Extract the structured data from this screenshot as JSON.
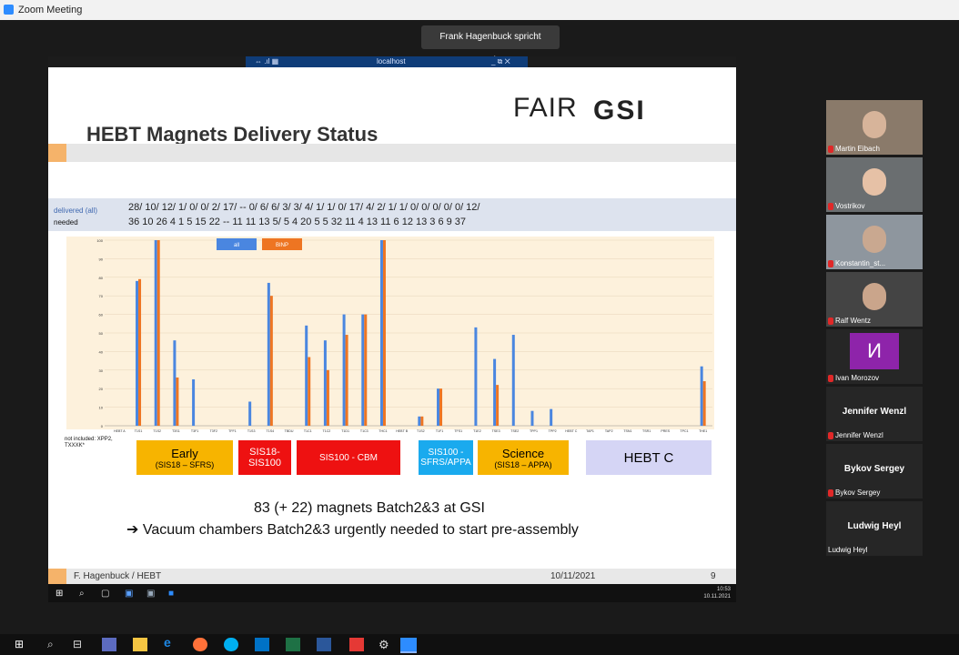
{
  "window": {
    "title": "Zoom Meeting"
  },
  "speaking_banner": "Frank Hagenbuck spricht gerade...",
  "remote_desktop": {
    "host": "localhost",
    "left_icons": "⇔ .ıl ▦",
    "controls": "_  ⧉  ✕"
  },
  "slide": {
    "logo_fair": "FAIR",
    "logo_gsi": "GSI",
    "title": "HEBT Magnets Delivery Status",
    "row_label_delivered": "delivered (all)",
    "row_label_needed": "needed",
    "delivered_values": "28/ 10/ 12/ 1/  0/  0/  2/ 17/ --  0/  6/  6/  3/  3/  4/      1/  1/  0/ 17/  4/  2/  1/  1/       0/  0/  0/  0/  0/  12/",
    "needed_values": "36 10 26  4   1   5  15 22  -- 11 11 13  5/  5   4      20  5   5 32 11  4 13 11       6 12 13  3  6   9 37",
    "not_included": "not included: XPP2, TXXXK*",
    "categories": [
      {
        "label": "Early",
        "sub": "(SIS18 – SFRS)",
        "color": "#f7b400"
      },
      {
        "label": "SIS18-",
        "sub": "SIS100",
        "color": "#ee1111"
      },
      {
        "label": "SIS100 - CBM",
        "sub": "",
        "color": "#ee1111"
      },
      {
        "label": "SIS100 -",
        "sub": "SFRS/APPA",
        "color": "#1aaaee"
      },
      {
        "label": "Science",
        "sub": "(SIS18 – APPA)",
        "color": "#f7b400"
      },
      {
        "label": "HEBT C",
        "sub": "",
        "color": "#d5d5f5"
      }
    ],
    "statement1": "83 (+ 22) magnets Batch2&3 at GSI",
    "statement2": "➔ Vacuum chambers Batch2&3 urgently needed to start pre-assembly",
    "footer_author": "F. Hagenbuck / HEBT",
    "footer_date": "10/11/2021",
    "footer_page": "9"
  },
  "chart_data": {
    "type": "bar",
    "ylim": [
      0,
      100
    ],
    "yticks": [
      0,
      10,
      20,
      30,
      40,
      50,
      60,
      70,
      80,
      90,
      100
    ],
    "categories": [
      "HEBT A",
      "T1S1",
      "T1S2",
      "T3S1",
      "T3F1",
      "T3F2",
      "TFF1",
      "T1S3",
      "T1S4",
      "TBDU",
      "T1C1",
      "T1C2",
      "T1D1",
      "T1C3",
      "THC1",
      "HEBT B",
      "T1S2",
      "T1F1",
      "TFS1",
      "T1E2",
      "TSE3",
      "TSE2",
      "TPP1",
      "TPP2",
      "HEBT C",
      "TAP1",
      "TAP2",
      "TSN1",
      "TSR1",
      "PRES",
      "TPC1",
      "THE1"
    ],
    "series": [
      {
        "name": "all",
        "color": "#4a86e0",
        "values": [
          0,
          78,
          100,
          46,
          25,
          0,
          0,
          13,
          77,
          0,
          54,
          46,
          60,
          60,
          100,
          0,
          5,
          20,
          0,
          53,
          36,
          49,
          8,
          9,
          0,
          0,
          0,
          0,
          0,
          0,
          0,
          32
        ]
      },
      {
        "name": "BINP",
        "color": "#ee7522",
        "values": [
          0,
          79,
          100,
          26,
          0,
          0,
          0,
          0,
          70,
          0,
          37,
          30,
          49,
          60,
          100,
          0,
          5,
          20,
          0,
          0,
          22,
          0,
          0,
          0,
          0,
          0,
          0,
          0,
          0,
          0,
          0,
          24
        ]
      }
    ],
    "legend": "top-center"
  },
  "remote_taskbar": {
    "time": "10:53",
    "date": "10.11.2021"
  },
  "participants": [
    {
      "name": "Martin Eibach",
      "video": true,
      "bg": "#8a7a6a",
      "face": "#d7b49a"
    },
    {
      "name": "Vostrikov",
      "video": true,
      "bg": "#6a6e70",
      "face": "#e6c1a6"
    },
    {
      "name": "Konstantin_st...",
      "video": true,
      "bg": "#8e969e",
      "face": "#c9a890"
    },
    {
      "name": "Ralf Wentz",
      "video": true,
      "bg": "#444",
      "face": "#caa58b"
    },
    {
      "name": "Ivan Morozov",
      "video": false,
      "avatar": "И",
      "avatar_color": "#8e24aa"
    },
    {
      "name": "Jennifer Wenzl",
      "video": false
    },
    {
      "name": "Bykov Sergey",
      "video": false
    },
    {
      "name": "Ludwig Heyl",
      "video": false
    }
  ]
}
